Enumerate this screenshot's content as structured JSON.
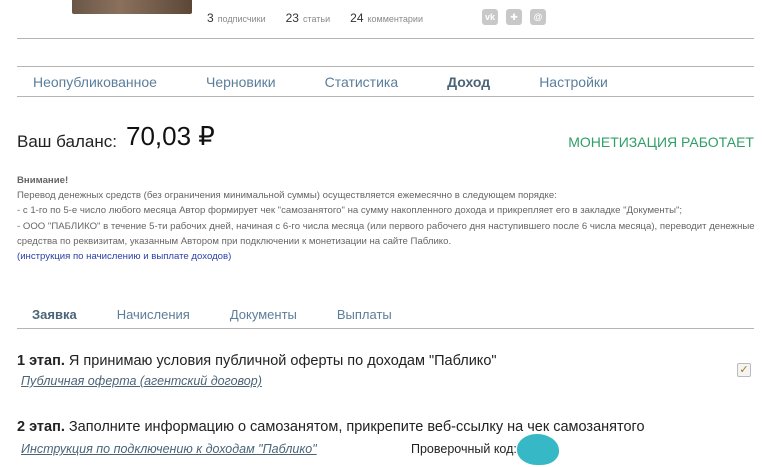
{
  "profile": {
    "stats": [
      {
        "num": "3",
        "label": "подписчики"
      },
      {
        "num": "23",
        "label": "статьи"
      },
      {
        "num": "24",
        "label": "комментарии"
      }
    ],
    "socials": [
      {
        "name": "vk-icon",
        "glyph": "vk"
      },
      {
        "name": "odnoklassniki-icon",
        "glyph": "✚"
      },
      {
        "name": "mail-icon",
        "glyph": "@"
      }
    ]
  },
  "tabs": [
    {
      "label": "Неопубликованное",
      "active": false
    },
    {
      "label": "Черновики",
      "active": false
    },
    {
      "label": "Статистика",
      "active": false
    },
    {
      "label": "Доход",
      "active": true
    },
    {
      "label": "Настройки",
      "active": false
    }
  ],
  "balance": {
    "label": "Ваш баланс:",
    "value": "70,03 ₽",
    "status": "МОНЕТИЗАЦИЯ РАБОТАЕТ"
  },
  "notice": {
    "heading": "Внимание!",
    "lines": [
      "Перевод денежных средств (без ограничения минимальной суммы) осуществляется ежемесячно в следующем порядке:",
      "- с 1-го по 5-е число любого месяца Автор формирует чек \"самозанятого\" на сумму накопленного дохода и прикрепляет его в закладке \"Документы\";",
      "- ООО \"ПАБЛИКО\" в течение 5-ти рабочих дней, начиная с 6-го числа месяца (или первого рабочего дня наступившего после 6 числа месяца), переводит денежные средства по реквизитам, указанным Автором при подключении к монетизации на сайте Паблико."
    ],
    "link": "(инструкция по начислению и выплате доходов)"
  },
  "subtabs": [
    {
      "label": "Заявка",
      "active": true
    },
    {
      "label": "Начисления",
      "active": false
    },
    {
      "label": "Документы",
      "active": false
    },
    {
      "label": "Выплаты",
      "active": false
    }
  ],
  "step1": {
    "bold": "1 этап.",
    "text": " Я принимаю условия публичной оферты по доходам \"Паблико\"",
    "link": "Публичная оферта (агентский договор)",
    "checked": true,
    "check_glyph": "✓"
  },
  "step2": {
    "bold": "2 этап.",
    "text": " Заполните информацию о самозанятом, прикрепите веб-ссылку на чек самозанятого",
    "link": "Инструкция по подключению к доходам \"Паблико\"",
    "code_label": "Проверочный код:"
  },
  "colors": {
    "accent_green": "#2f9e68",
    "tab_blue": "#5b7e9b",
    "link_blue": "#2a3fa8",
    "redaction": "#37b8c6"
  }
}
